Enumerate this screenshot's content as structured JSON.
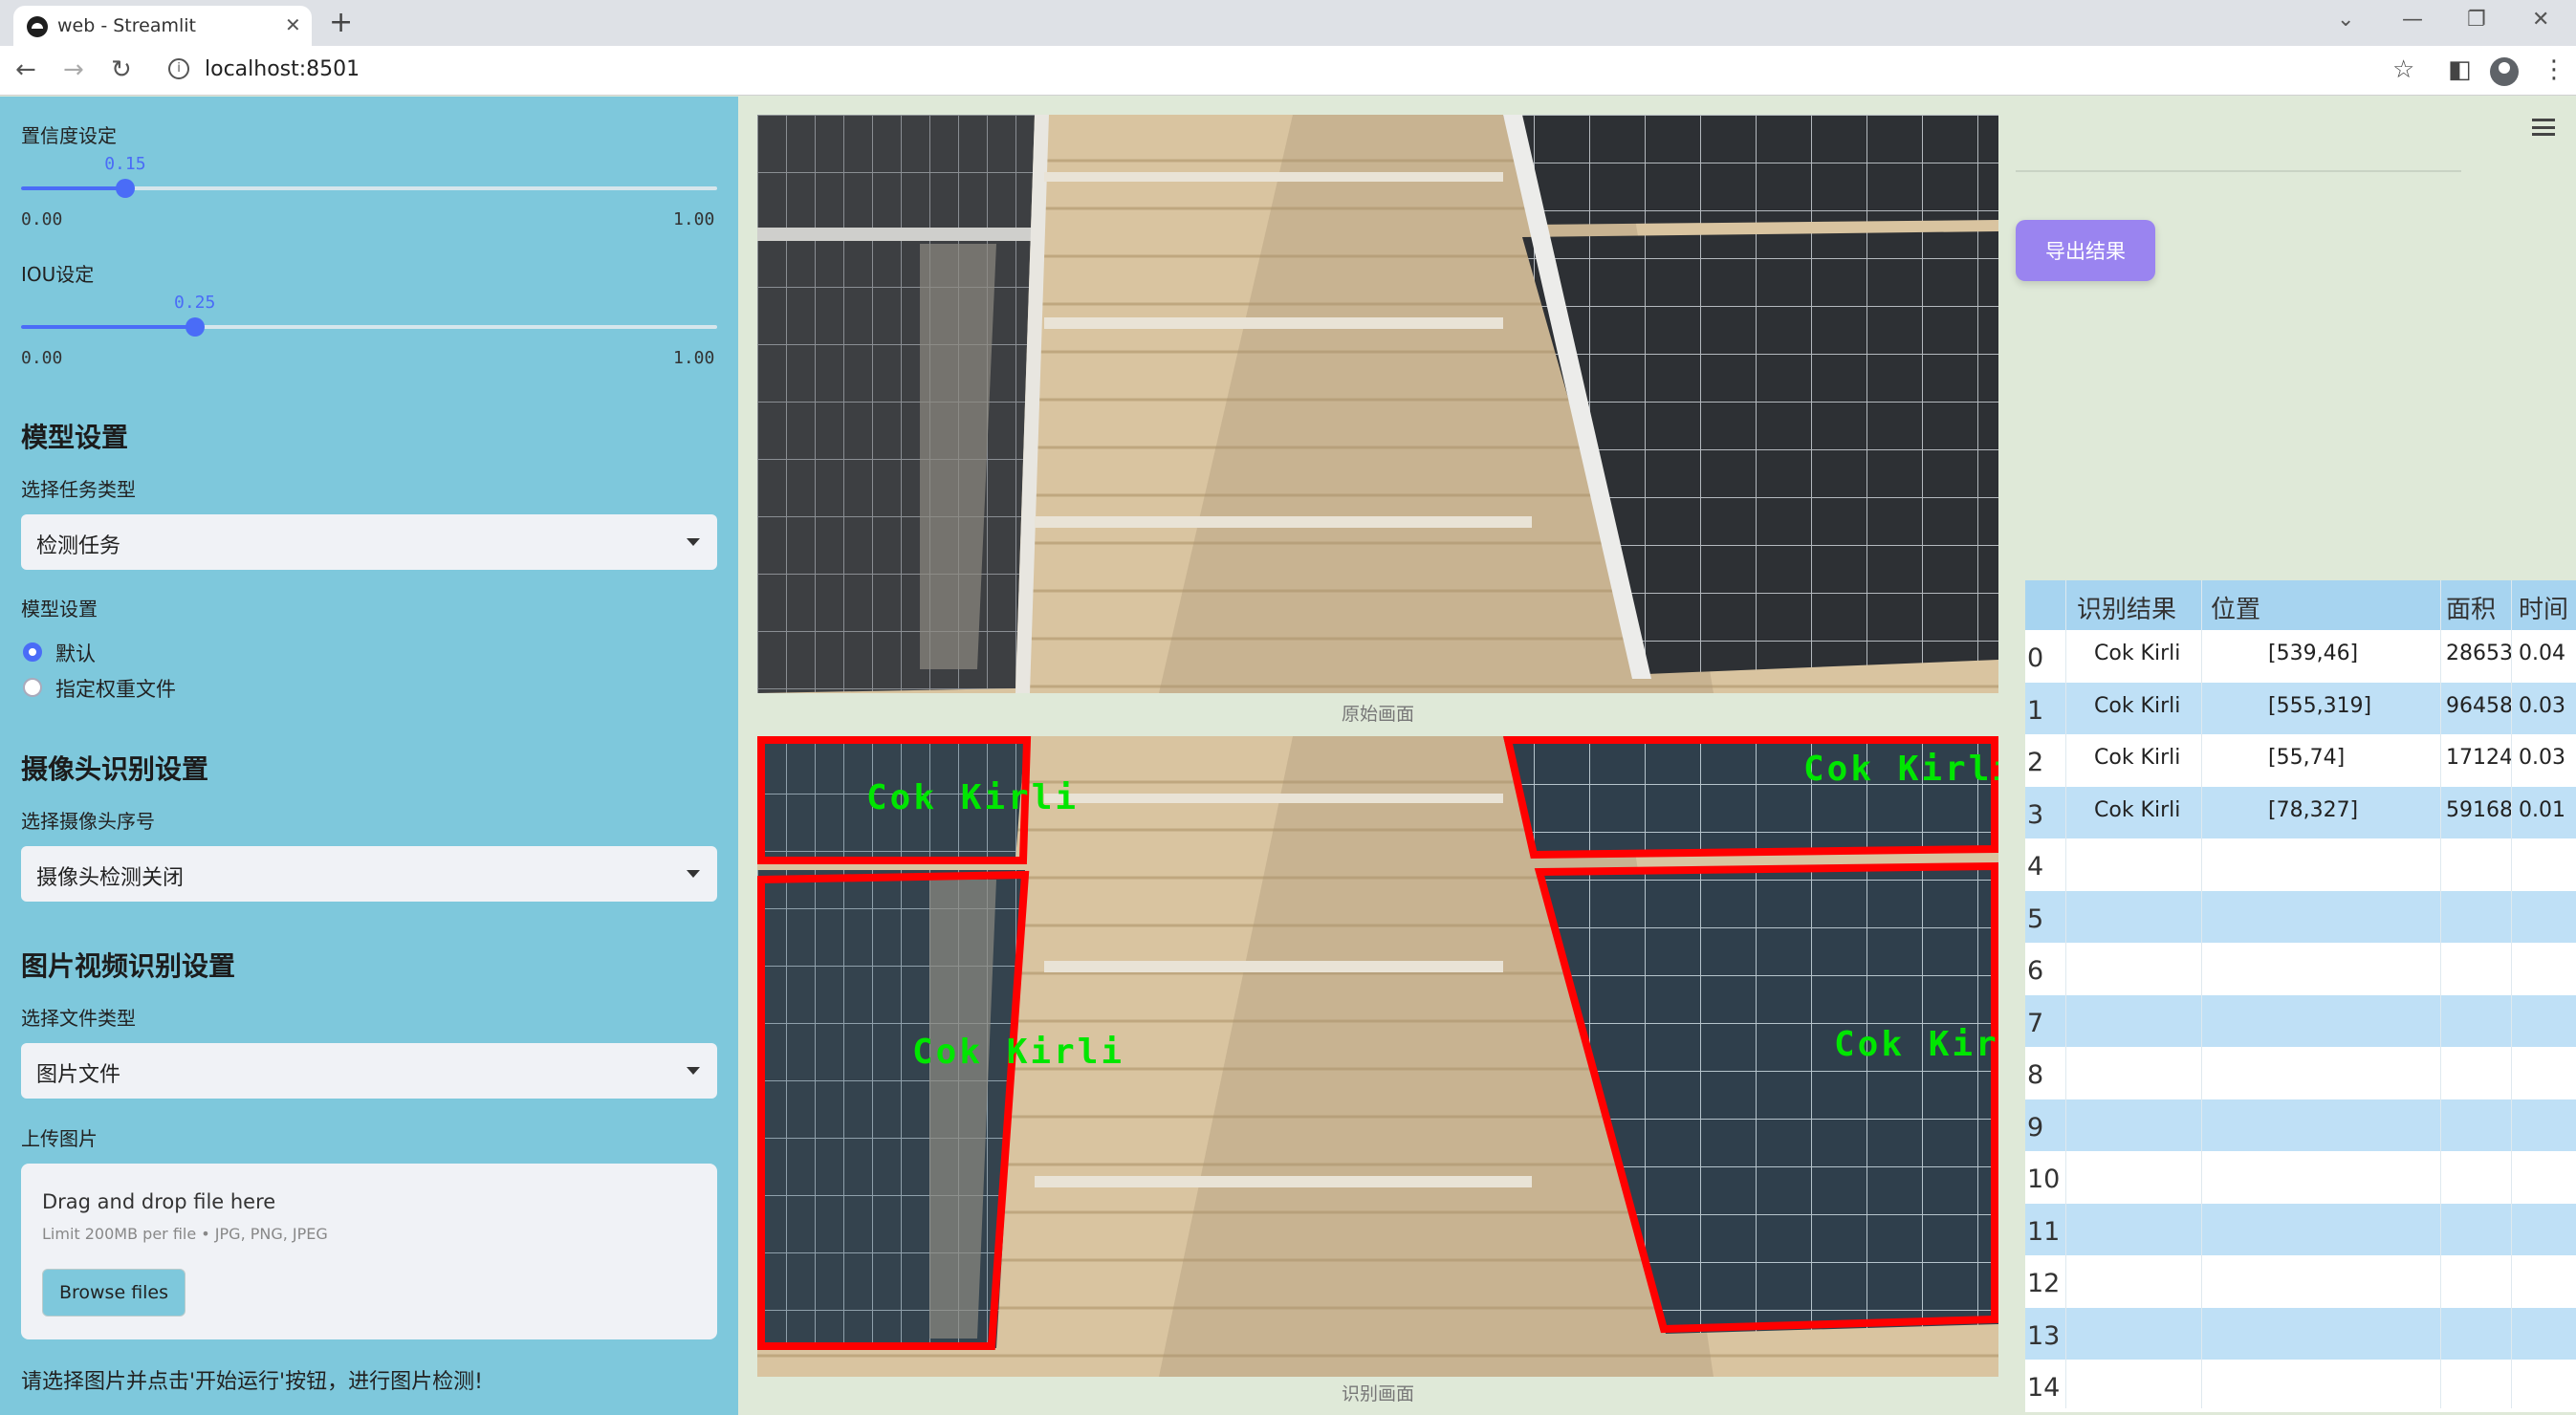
{
  "browser": {
    "tab_title": "web - Streamlit",
    "url": "localhost:8501"
  },
  "sidebar": {
    "confidence": {
      "label": "置信度设定",
      "value": "0.15",
      "min": "0.00",
      "max": "1.00",
      "fraction": 0.15
    },
    "iou": {
      "label": "IOU设定",
      "value": "0.25",
      "min": "0.00",
      "max": "1.00",
      "fraction": 0.25
    },
    "model_section_title": "模型设置",
    "task_type_label": "选择任务类型",
    "task_type_value": "检测任务",
    "model_label": "模型设置",
    "model_options": [
      {
        "label": "默认",
        "selected": true
      },
      {
        "label": "指定权重文件",
        "selected": false
      }
    ],
    "camera_section_title": "摄像头识别设置",
    "camera_label": "选择摄像头序号",
    "camera_value": "摄像头检测关闭",
    "media_section_title": "图片视频识别设置",
    "file_type_label": "选择文件类型",
    "file_type_value": "图片文件",
    "upload_label": "上传图片",
    "uploader": {
      "title": "Drag and drop file here",
      "limit": "Limit 200MB per file • JPG, PNG, JPEG",
      "button": "Browse files"
    },
    "hint": "请选择图片并点击'开始运行'按钮，进行图片检测!"
  },
  "main": {
    "original_caption": "原始画面",
    "result_caption": "识别画面",
    "detection_label": "Cok Kirli"
  },
  "right": {
    "export_button": "导出结果",
    "table": {
      "columns": [
        "识别结果",
        "位置",
        "面积",
        "时间"
      ],
      "rows": [
        {
          "index": "0",
          "result": "Cok Kirli",
          "position": "[539,46]",
          "area": "28653",
          "time": "0.04"
        },
        {
          "index": "1",
          "result": "Cok Kirli",
          "position": "[555,319]",
          "area": "96458",
          "time": "0.03"
        },
        {
          "index": "2",
          "result": "Cok Kirli",
          "position": "[55,74]",
          "area": "17124",
          "time": "0.03"
        },
        {
          "index": "3",
          "result": "Cok Kirli",
          "position": "[78,327]",
          "area": "59168",
          "time": "0.01"
        }
      ],
      "empty_indices": [
        "4",
        "5",
        "6",
        "7",
        "8",
        "9",
        "10",
        "11",
        "12",
        "13",
        "14"
      ]
    }
  },
  "colors": {
    "sidebar_bg": "#7ec8dc",
    "accent": "#4a6cf7",
    "export_button": "#9a84f0",
    "detection_box": "#ff0000",
    "detection_text": "#00e600",
    "table_header": "#a7d4f0",
    "table_row_alt": "#bfe0f6"
  }
}
